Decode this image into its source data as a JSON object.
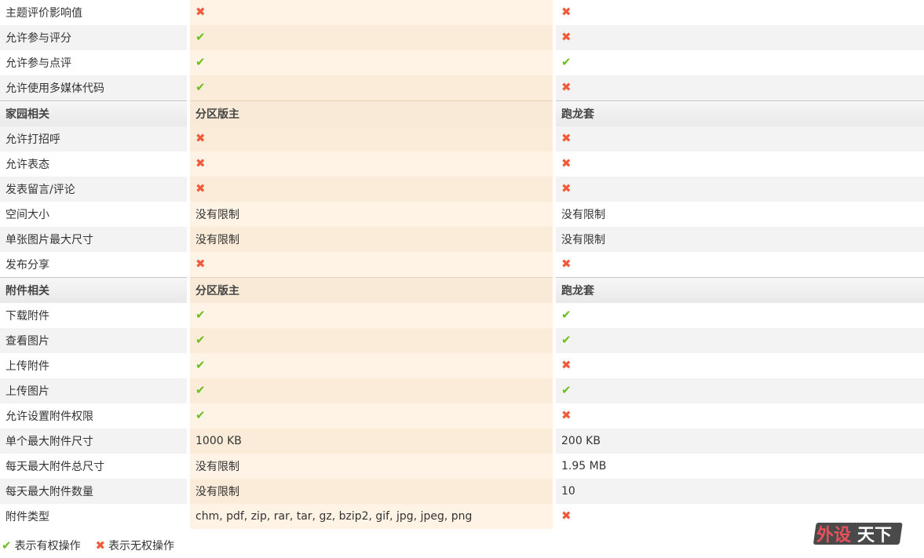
{
  "rows": [
    {
      "type": "row",
      "label": "主题评价影响值",
      "v1": "no",
      "v2": "no"
    },
    {
      "type": "row",
      "label": "允许参与评分",
      "v1": "yes",
      "v2": "no"
    },
    {
      "type": "row",
      "label": "允许参与点评",
      "v1": "yes",
      "v2": "yes"
    },
    {
      "type": "row",
      "label": "允许使用多媒体代码",
      "v1": "yes",
      "v2": "no"
    },
    {
      "type": "header",
      "label": "家园相关",
      "v1": "分区版主",
      "v2": "跑龙套"
    },
    {
      "type": "row",
      "label": "允许打招呼",
      "v1": "no",
      "v2": "no"
    },
    {
      "type": "row",
      "label": "允许表态",
      "v1": "no",
      "v2": "no"
    },
    {
      "type": "row",
      "label": "发表留言/评论",
      "v1": "no",
      "v2": "no"
    },
    {
      "type": "row",
      "label": "空间大小",
      "v1": "没有限制",
      "v2": "没有限制"
    },
    {
      "type": "row",
      "label": "单张图片最大尺寸",
      "v1": "没有限制",
      "v2": "没有限制"
    },
    {
      "type": "row",
      "label": "发布分享",
      "v1": "no",
      "v2": "no"
    },
    {
      "type": "header",
      "label": "附件相关",
      "v1": "分区版主",
      "v2": "跑龙套"
    },
    {
      "type": "row",
      "label": "下载附件",
      "v1": "yes",
      "v2": "yes"
    },
    {
      "type": "row",
      "label": "查看图片",
      "v1": "yes",
      "v2": "yes"
    },
    {
      "type": "row",
      "label": "上传附件",
      "v1": "yes",
      "v2": "no"
    },
    {
      "type": "row",
      "label": "上传图片",
      "v1": "yes",
      "v2": "yes"
    },
    {
      "type": "row",
      "label": "允许设置附件权限",
      "v1": "yes",
      "v2": "no"
    },
    {
      "type": "row",
      "label": "单个最大附件尺寸",
      "v1": "1000 KB",
      "v2": "200 KB"
    },
    {
      "type": "row",
      "label": "每天最大附件总尺寸",
      "v1": "没有限制",
      "v2": "1.95 MB"
    },
    {
      "type": "row",
      "label": "每天最大附件数量",
      "v1": "没有限制",
      "v2": "10"
    },
    {
      "type": "row",
      "label": "附件类型",
      "v1": "chm, pdf, zip, rar, tar, gz, bzip2, gif, jpg, jpeg, png",
      "v2": "no"
    }
  ],
  "legend": {
    "allowed_label": "表示有权操作",
    "denied_label": "表示无权操作"
  },
  "watermark": {
    "text": "外设天下"
  },
  "icons": {
    "yes": "check-icon",
    "no": "cross-icon"
  },
  "colors": {
    "check": "#6bbf1e",
    "cross": "#ef5b3b",
    "highlight_column": "#fef3e4"
  }
}
